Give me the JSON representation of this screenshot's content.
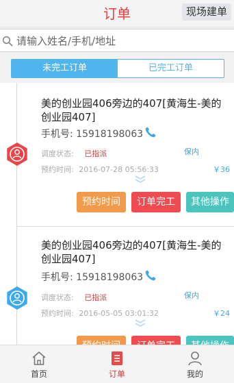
{
  "header": {
    "title": "订单",
    "action": "现场建单"
  },
  "search": {
    "placeholder": "请输入姓名/手机/地址",
    "icon": "search-icon"
  },
  "tabs": [
    {
      "label": "未完工订单",
      "active": true
    },
    {
      "label": "已完工订单",
      "active": false
    }
  ],
  "orders": [
    {
      "address": "美的创业园406旁边的407[黄海生-美的创业园407]",
      "phone_label": "手机号:",
      "phone": "15918198063",
      "status_label": "调度状态:",
      "status": "已指派",
      "tag": "保内",
      "time_label": "预约时间:",
      "time": "2016-07-28 05:56:33",
      "price": "￥36",
      "avatar_color": "#e9454b",
      "actions": [
        "预约时间",
        "订单完工",
        "其他操作"
      ]
    },
    {
      "address": "美的创业园406旁边的407[黄海生-美的创业园407]",
      "phone_label": "手机号:",
      "phone": "15918198063",
      "status_label": "调度状态:",
      "status": "已指派",
      "tag": "保内",
      "time_label": "预约时间:",
      "time": "2016-05-05 03:01:32",
      "price": "￥24",
      "avatar_color": "#3eaaec",
      "actions": [
        "预约时间",
        "订单完工",
        "其他操作"
      ]
    }
  ],
  "bottom_nav": [
    {
      "label": "首页",
      "icon": "home-icon",
      "active": false
    },
    {
      "label": "订单",
      "icon": "order-icon",
      "active": true
    },
    {
      "label": "我的",
      "icon": "user-icon",
      "active": false
    }
  ],
  "colors": {
    "accent_red": "#ee3b3b",
    "accent_blue": "#4fb5ee",
    "button_orange": "#f39a4a",
    "button_red": "#ef4b50",
    "button_teal": "#4ac4bd"
  }
}
